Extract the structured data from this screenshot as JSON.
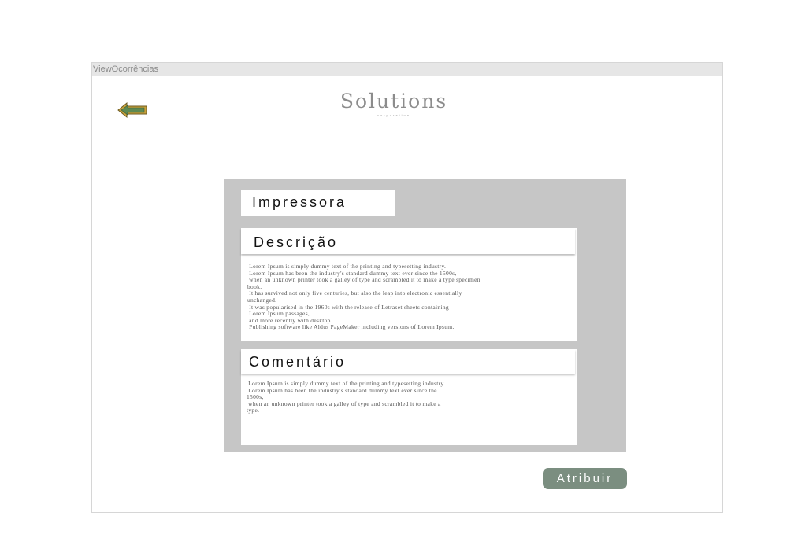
{
  "window": {
    "title": "ViewOcorrências"
  },
  "header": {
    "back_icon": "left-arrow-icon",
    "logo_name": "Solutions",
    "logo_tagline": "corporation"
  },
  "device": {
    "name": "Impressora"
  },
  "description": {
    "title": "Descrição",
    "body": " Lorem Ipsum is simply dummy text of the printing and typesetting industry.\n Lorem Ipsum has been the industry's standard dummy text ever since the 1500s,\n when an unknown printer took a galley of type and scrambled it to make a type specimen\nbook.\n It has survived not only five centuries, but also the leap into electronic essentially\nunchanged.\n It was popularised in the 1960s with the release of Letraset sheets containing\n Lorem Ipsum passages,\n and more recently with desktop.\n Publishing software like Aldus PageMaker including versions of Lorem Ipsum."
  },
  "comment": {
    "title": "Comentário",
    "body": " Lorem Ipsum is simply dummy text of the printing and typesetting industry.\n Lorem Ipsum has been the industry's standard dummy text ever since the\n1500s,\n when an unknown printer took a galley of type and scrambled it to make a\ntype."
  },
  "actions": {
    "assign_label": "Atribuir"
  },
  "colors": {
    "panel": "#c6c6c6",
    "button": "#7b8e80",
    "arrow_fill": "#5e8a52",
    "arrow_border": "#c8a23a"
  }
}
